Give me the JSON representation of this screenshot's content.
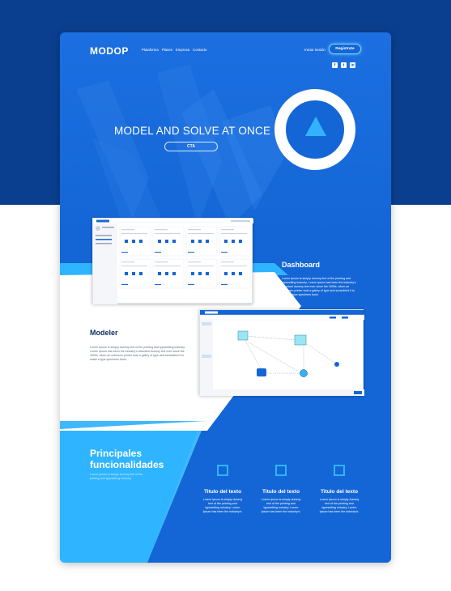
{
  "nav": {
    "logo": "MODOP",
    "menu": [
      "Plataforma",
      "Planes",
      "Empresa",
      "Contacto"
    ],
    "login": "Iniciar Sesión",
    "register": "Registrate",
    "social": [
      "f",
      "t",
      "in"
    ]
  },
  "hero": {
    "title": "MODEL AND SOLVE AT ONCE",
    "cta": "CTA"
  },
  "dashboard": {
    "title": "Dashboard",
    "text": "Lorem Ipsum is simply dummy text of the printing and typesetting industry. Lorem Ipsum has been the industry's standard dummy text ever since the 1500s, when an unknown printer took a galley of type and scrambled it to make a type specimen book."
  },
  "modeler": {
    "title": "Modeler",
    "text": "Lorem Ipsum is simply dummy text of the printing and typesetting industry. Lorem Ipsum has been the industry's standard dummy text ever since the 1500s, when an unknown printer took a galley of type and scrambled it to make a type specimen book."
  },
  "features": {
    "title_line1": "Principales",
    "title_line2": "funcionalidades",
    "text": "Lorem Ipsum is simply dummy text of the printing and typesetting industry.",
    "items": [
      {
        "title": "Titulo del texto",
        "text": "Lorem Ipsum is simply dummy text of the printing and typesetting industry. Lorem Ipsum has been the industry's."
      },
      {
        "title": "Titulo del texto",
        "text": "Lorem Ipsum is simply dummy text of the printing and typesetting industry. Lorem Ipsum has been the industry's."
      },
      {
        "title": "Titulo del texto",
        "text": "Lorem Ipsum is simply dummy text of the printing and typesetting industry. Lorem Ipsum has been the industry's."
      }
    ]
  },
  "colors": {
    "band": "#0a3f8f",
    "primary": "#1466d6",
    "accent": "#2fb5ff",
    "dark_text": "#0d2f66"
  }
}
